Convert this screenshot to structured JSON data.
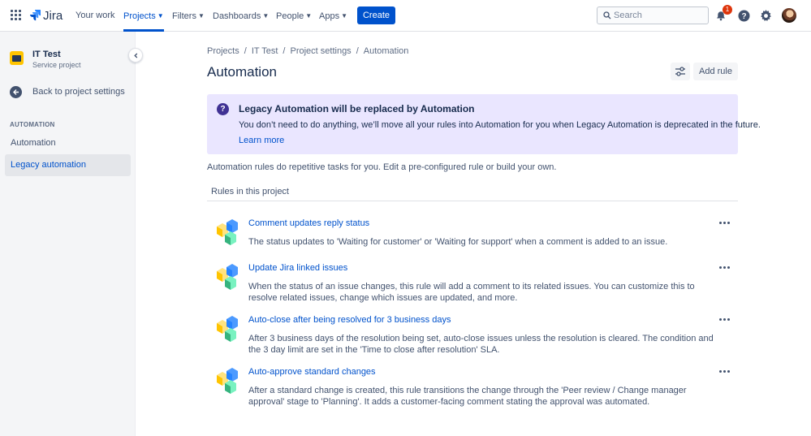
{
  "topnav": {
    "logo": "Jira",
    "items": [
      {
        "label": "Your work",
        "dropdown": false
      },
      {
        "label": "Projects",
        "dropdown": true,
        "active": true
      },
      {
        "label": "Filters",
        "dropdown": true
      },
      {
        "label": "Dashboards",
        "dropdown": true
      },
      {
        "label": "People",
        "dropdown": true
      },
      {
        "label": "Apps",
        "dropdown": true
      }
    ],
    "create_label": "Create",
    "search_placeholder": "Search",
    "notification_count": "1"
  },
  "sidebar": {
    "project_name": "IT Test",
    "project_type": "Service project",
    "back_label": "Back to project settings",
    "section_header": "AUTOMATION",
    "items": [
      {
        "label": "Automation",
        "selected": false
      },
      {
        "label": "Legacy automation",
        "selected": true
      }
    ]
  },
  "breadcrumb": [
    "Projects",
    "IT Test",
    "Project settings",
    "Automation"
  ],
  "page_title": "Automation",
  "add_rule_label": "Add rule",
  "banner": {
    "title": "Legacy Automation will be replaced by Automation",
    "body": "You don’t need to do anything, we’ll move all your rules into Automation for you when Legacy Automation is deprecated in the future.",
    "link": "Learn more"
  },
  "intro": "Automation rules do repetitive tasks for you. Edit a pre-configured rule or build your own.",
  "rules_header": "Rules in this project",
  "rules": [
    {
      "title": "Comment updates reply status",
      "description": "The status updates to 'Waiting for customer' or 'Waiting for support' when a comment is added to an issue."
    },
    {
      "title": "Update Jira linked issues",
      "description": "When the status of an issue changes, this rule will add a comment to its related issues. You can customize this to resolve related issues, change which issues are updated, and more."
    },
    {
      "title": "Auto-close after being resolved for 3 business days",
      "description": "After 3 business days of the resolution being set, auto-close issues unless the resolution is cleared. The condition and the 3 day limit are set in the 'Time to close after resolution' SLA."
    },
    {
      "title": "Auto-approve standard changes",
      "description": "After a standard change is created, this rule transitions the change through the 'Peer review / Change manager approval' stage to 'Planning'. It adds a customer-facing comment stating the approval was automated."
    }
  ],
  "colors": {
    "brand": "#0052cc",
    "banner_bg": "#eae6ff",
    "banner_icon": "#403294",
    "badge": "#de350b"
  }
}
